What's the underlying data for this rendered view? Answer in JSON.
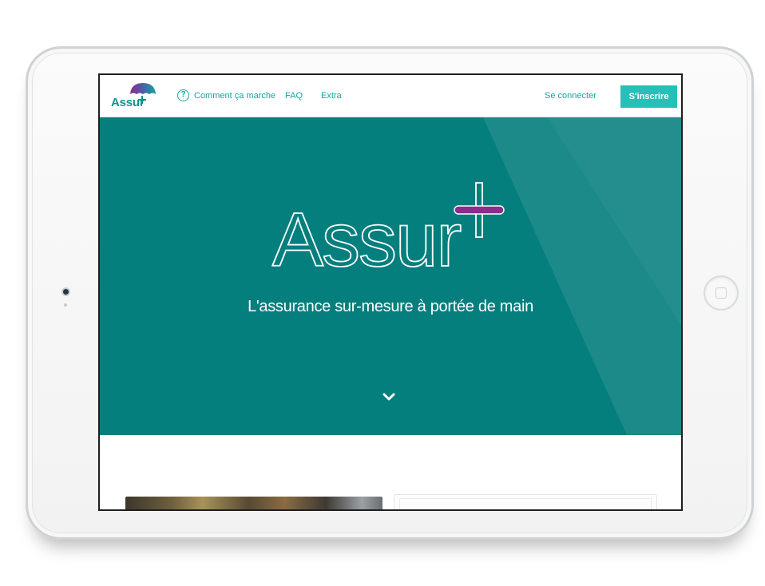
{
  "nav": {
    "logo_text": "Assur",
    "help_icon_glyph": "?",
    "links": {
      "how_it_works": "Comment ça marche",
      "faq": "FAQ",
      "extra": "Extra"
    },
    "login": "Se connecter",
    "signup": "S'inscrire"
  },
  "hero": {
    "brand": "Assur",
    "tagline": "L'assurance sur-mesure à portée de main"
  },
  "icons": {
    "help": "question-circle-icon",
    "scroll": "chevron-down-icon",
    "logo_mark": "umbrella-plus-icon"
  },
  "colors": {
    "brand_teal": "#057f7e",
    "accent_teal": "#27c0b8",
    "link_teal": "#18a39d",
    "accent_purple": "#8c2c8c"
  }
}
